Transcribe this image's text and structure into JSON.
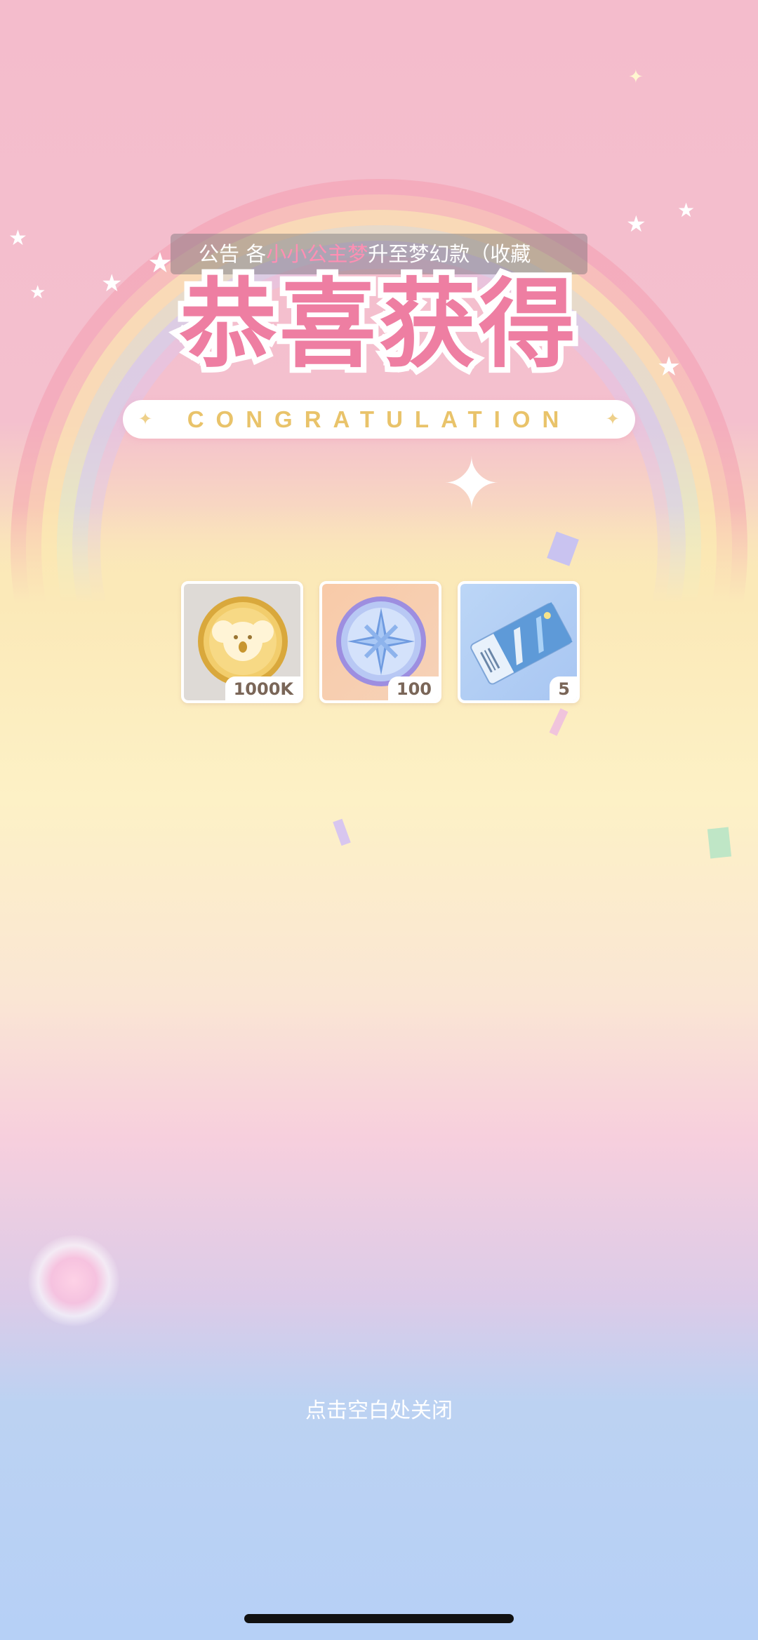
{
  "announcement": {
    "prefix": "公告   各",
    "highlight": "小小公主梦",
    "suffix": "升至梦幻款（收藏"
  },
  "title": {
    "main": "恭喜获得",
    "subtitle": "CONGRATULATION"
  },
  "rewards": [
    {
      "name": "koala-coin",
      "icon": "koala-coin-icon",
      "quantity": "1000K"
    },
    {
      "name": "star-crystal-coin",
      "icon": "compass-star-coin-icon",
      "quantity": "100"
    },
    {
      "name": "ticket",
      "icon": "ticket-icon",
      "quantity": "5"
    }
  ],
  "close_hint": "点击空白处关闭",
  "colors": {
    "title_pink": "#ee7ea2",
    "subtitle_gold": "#e9c36a",
    "highlight_pink": "#ff8fb3"
  }
}
